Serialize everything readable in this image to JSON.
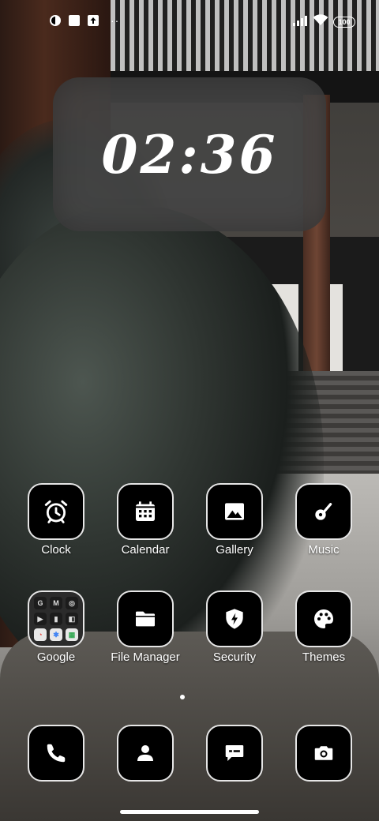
{
  "status_bar": {
    "left_icons": [
      "notification-icon",
      "square-icon",
      "upload-icon"
    ],
    "more_dots": "··",
    "right_icons": [
      "signal-icon",
      "wifi-icon"
    ],
    "battery": "100"
  },
  "clock": {
    "time": "02:36"
  },
  "apps": [
    {
      "label": "Clock",
      "icon": "alarm-clock-icon"
    },
    {
      "label": "Calendar",
      "icon": "calendar-icon"
    },
    {
      "label": "Gallery",
      "icon": "image-icon"
    },
    {
      "label": "Music",
      "icon": "music-note-icon"
    },
    {
      "label": "Google",
      "icon": "folder-icon"
    },
    {
      "label": "File Manager",
      "icon": "folder-icon"
    },
    {
      "label": "Security",
      "icon": "shield-bolt-icon"
    },
    {
      "label": "Themes",
      "icon": "palette-icon"
    }
  ],
  "folder_apps": [
    "G",
    "M",
    "◎",
    "▶",
    "▮",
    "◧",
    "◔",
    "✱",
    "▦"
  ],
  "dock": [
    {
      "icon": "phone-icon"
    },
    {
      "icon": "contacts-icon"
    },
    {
      "icon": "messages-icon"
    },
    {
      "icon": "camera-icon"
    }
  ],
  "colors": {
    "icon_bg": "#000000",
    "icon_border": "#e6e6e6",
    "label": "#ffffff",
    "widget_bg": "#464646"
  }
}
